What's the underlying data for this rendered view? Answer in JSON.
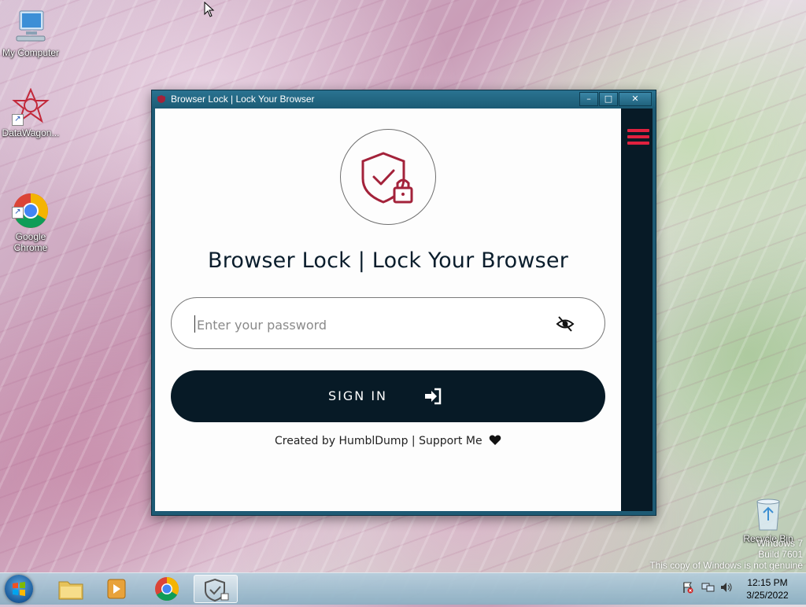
{
  "desktop": {
    "icons": [
      {
        "label": "My Computer",
        "icon": "computer-icon"
      },
      {
        "label": "DataWagon...",
        "icon": "datawagon-icon"
      },
      {
        "label": "Google\nChrome",
        "icon": "chrome-icon"
      },
      {
        "label": "Recycle Bin",
        "icon": "recycle-bin-icon"
      }
    ],
    "watermark": {
      "line1": "Windows 7",
      "line2": "Build 7601",
      "line3": "This copy of Windows is not genuine"
    }
  },
  "window": {
    "title": "Browser Lock | Lock Your Browser",
    "controls": {
      "minimize": "–",
      "maximize": "□",
      "close": "✕"
    },
    "app": {
      "heading": "Browser Lock | Lock Your Browser",
      "password": {
        "placeholder": "Enter your password",
        "value": ""
      },
      "signin_label": "SIGN IN",
      "credits": "Created by HumblDump | Support Me"
    },
    "colors": {
      "accent": "#e0213f",
      "dark": "#071a26",
      "logo": "#a3223a"
    }
  },
  "taskbar": {
    "items": [
      "start-button",
      "file-explorer",
      "media-player",
      "google-chrome",
      "browser-lock"
    ],
    "active": "browser-lock",
    "clock": {
      "time": "12:15 PM",
      "date": "3/25/2022"
    }
  }
}
